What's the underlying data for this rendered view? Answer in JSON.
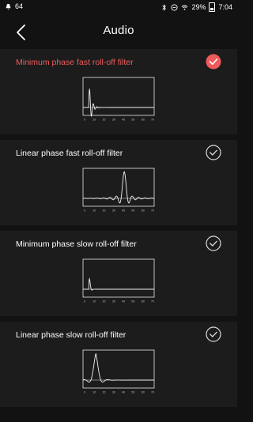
{
  "status": {
    "notif": "64",
    "battery": "29%",
    "time": "7:04"
  },
  "header": {
    "title": "Audio"
  },
  "filters": [
    {
      "label": "Minimum phase fast roll-off filter",
      "selected": true,
      "type": "min-fast"
    },
    {
      "label": "Linear phase fast roll-off filter",
      "selected": false,
      "type": "lin-fast"
    },
    {
      "label": "Minimum phase slow roll-off filter",
      "selected": false,
      "type": "min-slow"
    },
    {
      "label": "Linear phase slow roll-off filter",
      "selected": false,
      "type": "lin-slow"
    }
  ],
  "graph_ticks": [
    "0",
    "10",
    "20",
    "30",
    "40",
    "50",
    "60",
    "70"
  ],
  "colors": {
    "accent": "#ef5b5b",
    "background": "#121212",
    "card": "#1c1c1c"
  }
}
